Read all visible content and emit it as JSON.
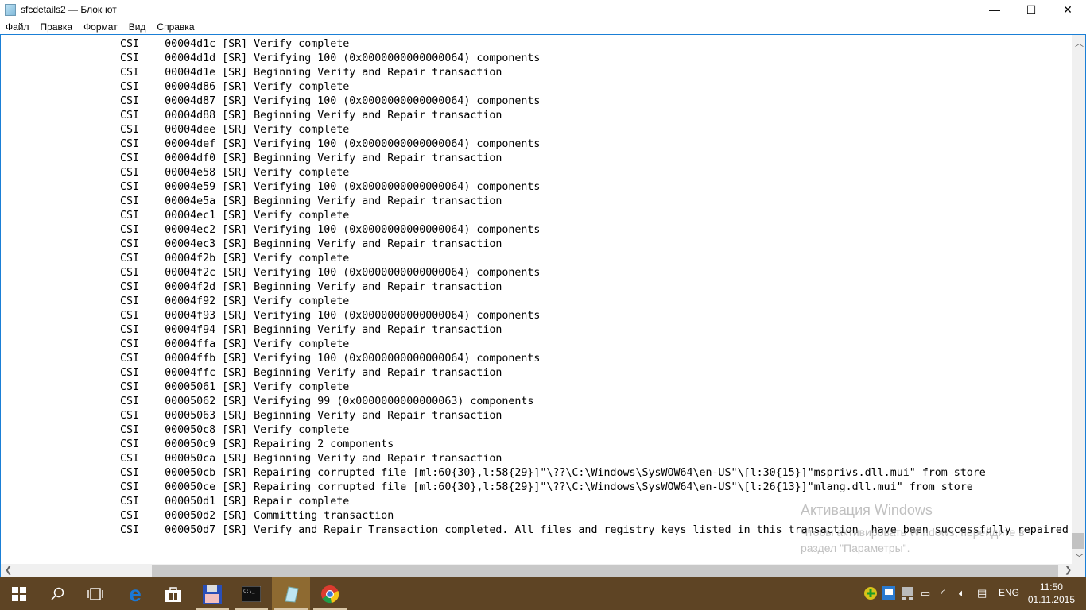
{
  "window": {
    "title": "sfcdetails2 — Блокнот",
    "minimize": "—",
    "maximize": "☐",
    "close": "✕"
  },
  "menu": [
    "Файл",
    "Правка",
    "Формат",
    "Вид",
    "Справка"
  ],
  "lines": [
    [
      "CSI",
      "00004d1c",
      "[SR] Verify complete"
    ],
    [
      "CSI",
      "00004d1d",
      "[SR] Verifying 100 (0x0000000000000064) components"
    ],
    [
      "CSI",
      "00004d1e",
      "[SR] Beginning Verify and Repair transaction"
    ],
    [
      "CSI",
      "00004d86",
      "[SR] Verify complete"
    ],
    [
      "CSI",
      "00004d87",
      "[SR] Verifying 100 (0x0000000000000064) components"
    ],
    [
      "CSI",
      "00004d88",
      "[SR] Beginning Verify and Repair transaction"
    ],
    [
      "CSI",
      "00004dee",
      "[SR] Verify complete"
    ],
    [
      "CSI",
      "00004def",
      "[SR] Verifying 100 (0x0000000000000064) components"
    ],
    [
      "CSI",
      "00004df0",
      "[SR] Beginning Verify and Repair transaction"
    ],
    [
      "CSI",
      "00004e58",
      "[SR] Verify complete"
    ],
    [
      "CSI",
      "00004e59",
      "[SR] Verifying 100 (0x0000000000000064) components"
    ],
    [
      "CSI",
      "00004e5a",
      "[SR] Beginning Verify and Repair transaction"
    ],
    [
      "CSI",
      "00004ec1",
      "[SR] Verify complete"
    ],
    [
      "CSI",
      "00004ec2",
      "[SR] Verifying 100 (0x0000000000000064) components"
    ],
    [
      "CSI",
      "00004ec3",
      "[SR] Beginning Verify and Repair transaction"
    ],
    [
      "CSI",
      "00004f2b",
      "[SR] Verify complete"
    ],
    [
      "CSI",
      "00004f2c",
      "[SR] Verifying 100 (0x0000000000000064) components"
    ],
    [
      "CSI",
      "00004f2d",
      "[SR] Beginning Verify and Repair transaction"
    ],
    [
      "CSI",
      "00004f92",
      "[SR] Verify complete"
    ],
    [
      "CSI",
      "00004f93",
      "[SR] Verifying 100 (0x0000000000000064) components"
    ],
    [
      "CSI",
      "00004f94",
      "[SR] Beginning Verify and Repair transaction"
    ],
    [
      "CSI",
      "00004ffa",
      "[SR] Verify complete"
    ],
    [
      "CSI",
      "00004ffb",
      "[SR] Verifying 100 (0x0000000000000064) components"
    ],
    [
      "CSI",
      "00004ffc",
      "[SR] Beginning Verify and Repair transaction"
    ],
    [
      "CSI",
      "00005061",
      "[SR] Verify complete"
    ],
    [
      "CSI",
      "00005062",
      "[SR] Verifying 99 (0x0000000000000063) components"
    ],
    [
      "CSI",
      "00005063",
      "[SR] Beginning Verify and Repair transaction"
    ],
    [
      "CSI",
      "000050c8",
      "[SR] Verify complete"
    ],
    [
      "CSI",
      "000050c9",
      "[SR] Repairing 2 components"
    ],
    [
      "CSI",
      "000050ca",
      "[SR] Beginning Verify and Repair transaction"
    ],
    [
      "CSI",
      "000050cb",
      "[SR] Repairing corrupted file [ml:60{30},l:58{29}]\"\\??\\C:\\Windows\\SysWOW64\\en-US\"\\[l:30{15}]\"msprivs.dll.mui\" from store"
    ],
    [
      "CSI",
      "000050ce",
      "[SR] Repairing corrupted file [ml:60{30},l:58{29}]\"\\??\\C:\\Windows\\SysWOW64\\en-US\"\\[l:26{13}]\"mlang.dll.mui\" from store"
    ],
    [
      "CSI",
      "000050d1",
      "[SR] Repair complete"
    ],
    [
      "CSI",
      "000050d2",
      "[SR] Committing transaction"
    ],
    [
      "CSI",
      "000050d7",
      "[SR] Verify and Repair Transaction completed. All files and registry keys listed in this transaction  have been successfully repaired"
    ]
  ],
  "watermark": {
    "title": "Активация Windows",
    "line1": "Чтобы активировать Windows, перейдите в",
    "line2": "раздел \"Параметры\"."
  },
  "tray": {
    "language": "ENG",
    "time": "11:50",
    "date": "01.11.2015"
  }
}
